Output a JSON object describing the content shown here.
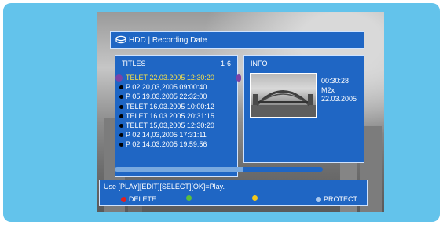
{
  "header": {
    "title": "HDD | Recording Date",
    "icon": "disc-stack-icon"
  },
  "titles_panel": {
    "heading": "TITLES",
    "count": "1-6",
    "items": [
      "TELET 22.03.2005 12:30:20",
      "P 02 20,03,2005 09:00:40",
      "P 05 19.03.2005 22:32:00",
      "TELET 16.03.2005 10:00:12",
      "TELET 16.03.2005 20:31:15",
      "TELET 15,03,2005 12:30:20",
      "P 02 14,03,2005 17:31:11",
      "P 02 14.03.2005 19:59:56"
    ],
    "selected_index": 0,
    "selected_color": "#f5e04a"
  },
  "info_panel": {
    "heading": "INFO",
    "duration": "00:30:28",
    "mode": "M2x",
    "date": "22.03.2005"
  },
  "progress": {
    "fraction": 0.62
  },
  "footer": {
    "help": "Use [PLAY][EDIT][SELECT][OK]=Play.",
    "keys": [
      {
        "color": "#e02020",
        "label": "DELETE"
      },
      {
        "color": "#5bbf3a",
        "label": ""
      },
      {
        "color": "#f2c81c",
        "label": ""
      },
      {
        "color": "#a9c8ee",
        "label": "PROTECT"
      }
    ]
  },
  "colors": {
    "osd_blue": "#1f66c4",
    "frame": "#63c3eb"
  }
}
